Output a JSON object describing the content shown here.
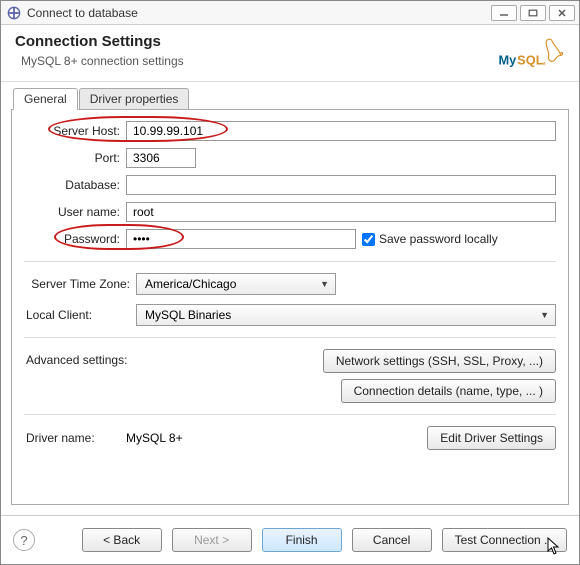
{
  "window": {
    "title": "Connect to database"
  },
  "header": {
    "title": "Connection Settings",
    "subtitle": "MySQL 8+ connection settings",
    "logo_text": "MySQL"
  },
  "tabs": {
    "general": "General",
    "driver_props": "Driver properties"
  },
  "form": {
    "server_host_label": "Server Host:",
    "server_host_value": "10.99.99.101",
    "port_label": "Port:",
    "port_value": "3306",
    "database_label": "Database:",
    "database_value": "",
    "username_label": "User name:",
    "username_value": "root",
    "password_label": "Password:",
    "password_value": "••••",
    "save_password_label": "Save password locally",
    "tz_label": "Server Time Zone:",
    "tz_value": "America/Chicago",
    "local_client_label": "Local Client:",
    "local_client_value": "MySQL Binaries",
    "adv_label": "Advanced settings:",
    "net_settings_btn": "Network settings (SSH, SSL, Proxy, ...)",
    "conn_details_btn": "Connection details (name, type, ... )",
    "driver_name_label": "Driver name:",
    "driver_name_value": "MySQL 8+",
    "edit_driver_btn": "Edit Driver Settings"
  },
  "footer": {
    "back": "< Back",
    "next": "Next >",
    "finish": "Finish",
    "cancel": "Cancel",
    "test": "Test Connection ..."
  }
}
